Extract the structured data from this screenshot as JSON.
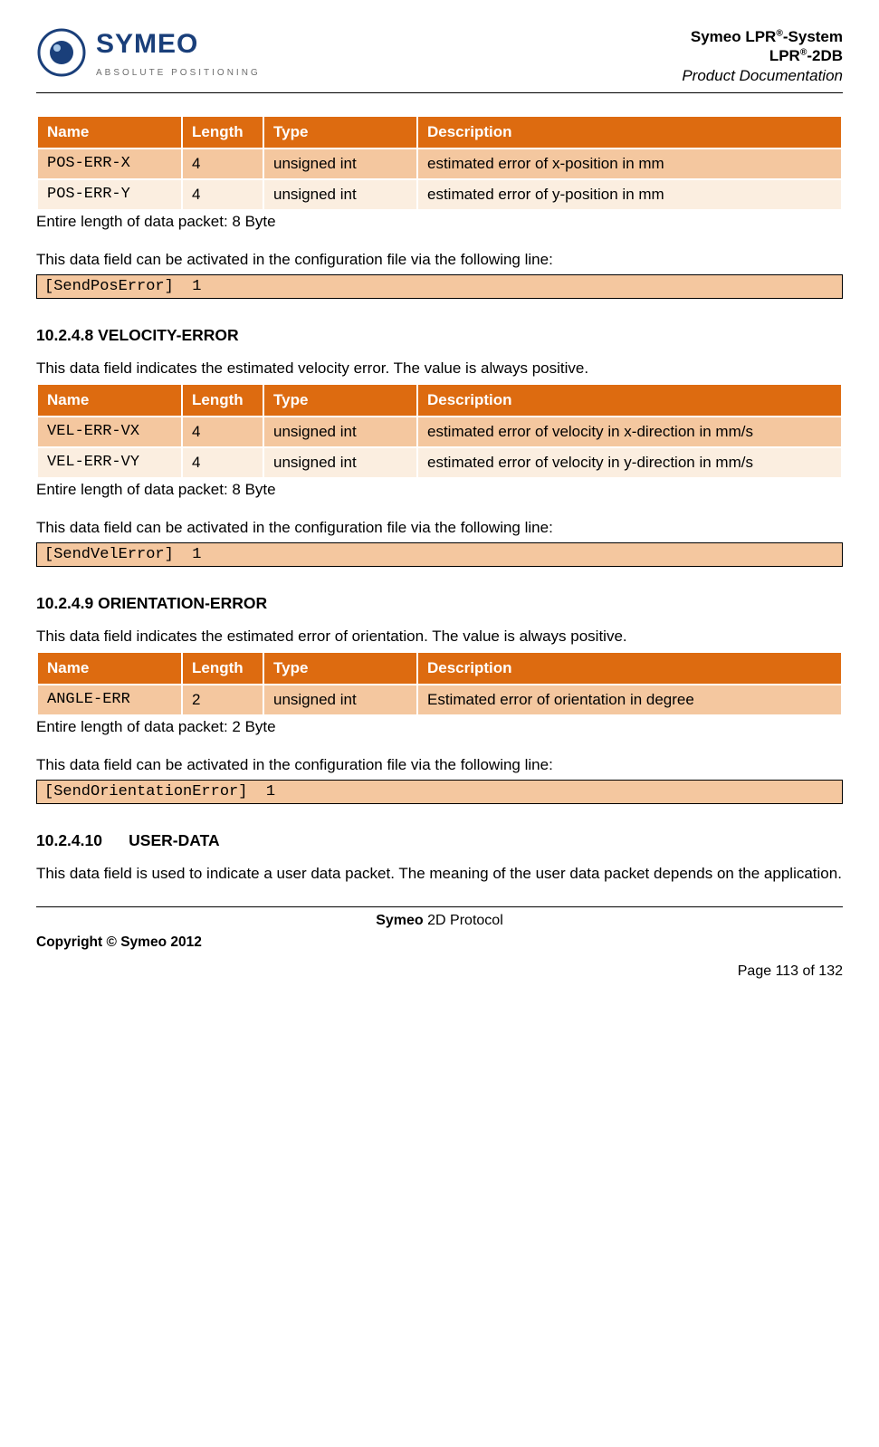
{
  "header": {
    "logo_text": "SYMEO",
    "logo_tag": "ABSOLUTE POSITIONING",
    "line1_pre": "Symeo LPR",
    "line1_sup": "®",
    "line1_post": "-System",
    "line2_pre": "LPR",
    "line2_sup": "®",
    "line2_post": "-2DB",
    "line3": "Product Documentation"
  },
  "section1": {
    "headers": {
      "name": "Name",
      "len": "Length",
      "type": "Type",
      "desc": "Description"
    },
    "rows": [
      {
        "name": "POS-ERR-X",
        "len": "4",
        "type": "unsigned int",
        "desc": "estimated error of x-position in mm"
      },
      {
        "name": "POS-ERR-Y",
        "len": "4",
        "type": "unsigned int",
        "desc": "estimated error of y-position in mm"
      }
    ],
    "note": "Entire length of data packet: 8 Byte",
    "intro2": "This data field can be activated in the configuration file via the following line:",
    "code": "[SendPosError]  1"
  },
  "section2": {
    "title": "10.2.4.8 VELOCITY-ERROR",
    "intro": "This data field indicates the estimated velocity error. The value is always positive.",
    "headers": {
      "name": "Name",
      "len": "Length",
      "type": "Type",
      "desc": "Description"
    },
    "rows": [
      {
        "name": "VEL-ERR-VX",
        "len": "4",
        "type": "unsigned int",
        "desc": "estimated error of velocity in x-direction in mm/s"
      },
      {
        "name": "VEL-ERR-VY",
        "len": "4",
        "type": "unsigned int",
        "desc": "estimated error of velocity in y-direction in mm/s"
      }
    ],
    "note": "Entire length of data packet: 8 Byte",
    "intro2": "This data field can be activated in the configuration file via the following line:",
    "code": "[SendVelError]  1"
  },
  "section3": {
    "title": "10.2.4.9 ORIENTATION-ERROR",
    "intro": "This data field indicates the estimated error of orientation. The value is always positive.",
    "headers": {
      "name": "Name",
      "len": "Length",
      "type": "Type",
      "desc": "Description"
    },
    "rows": [
      {
        "name": "ANGLE-ERR",
        "len": "2",
        "type": "unsigned int",
        "desc": "Estimated error of orientation in degree"
      }
    ],
    "note": "Entire length of data packet: 2 Byte",
    "intro2": "This data field can be activated in the configuration file via the following line:",
    "code": "[SendOrientationError]  1"
  },
  "section4": {
    "title": "10.2.4.10      USER-DATA",
    "intro": "This data field is used to indicate a user data packet. The meaning of the user data packet depends on the application."
  },
  "footer": {
    "center_bold": "Symeo",
    "center_rest": " 2D Protocol",
    "left": "Copyright © Symeo 2012",
    "page": "Page 113 of 132"
  }
}
